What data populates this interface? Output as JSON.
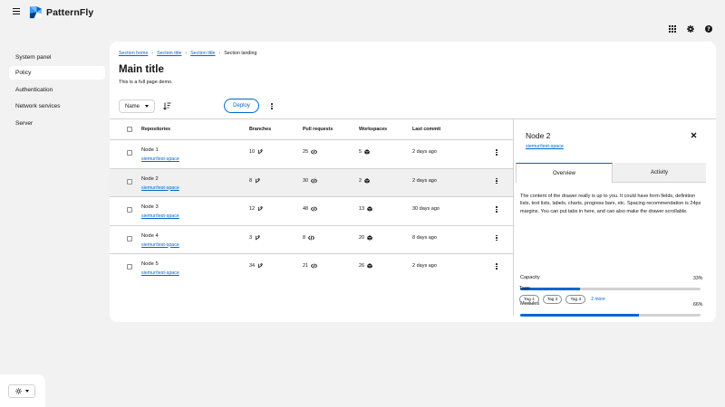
{
  "masthead": {
    "brand": "PatternFly",
    "tools": [
      "apps-grid-icon",
      "gear-icon",
      "help-icon"
    ]
  },
  "sidebar": {
    "items": [
      {
        "label": "System panel",
        "active": false
      },
      {
        "label": "Policy",
        "active": true
      },
      {
        "label": "Authentication",
        "active": false
      },
      {
        "label": "Network services",
        "active": false
      },
      {
        "label": "Server",
        "active": false
      }
    ],
    "theme_icon": "sun-icon"
  },
  "breadcrumb": {
    "items": [
      "Section home",
      "Section title",
      "Section title"
    ],
    "current": "Section landing"
  },
  "page": {
    "title": "Main title",
    "description": "This is a full page demo."
  },
  "toolbar": {
    "select_value": "Name",
    "deploy_label": "Deploy"
  },
  "table": {
    "columns": [
      "Repositories",
      "Branches",
      "Pull requests",
      "Workspaces",
      "Last commit"
    ],
    "rows": [
      {
        "name": "Node 1",
        "link": "siemur/test-space",
        "branches": "10",
        "prs": "25",
        "workspaces": "5",
        "last_commit": "2 days ago",
        "selected": false
      },
      {
        "name": "Node 2",
        "link": "siemur/test-space",
        "branches": "8",
        "prs": "30",
        "workspaces": "2",
        "last_commit": "2 days ago",
        "selected": true
      },
      {
        "name": "Node 3",
        "link": "siemur/test-space",
        "branches": "12",
        "prs": "48",
        "workspaces": "13",
        "last_commit": "30 days ago",
        "selected": false
      },
      {
        "name": "Node 4",
        "link": "siemur/test-space",
        "branches": "3",
        "prs": "8",
        "workspaces": "20",
        "last_commit": "8 days ago",
        "selected": false
      },
      {
        "name": "Node 5",
        "link": "siemur/test-space",
        "branches": "34",
        "prs": "21",
        "workspaces": "26",
        "last_commit": "2 days ago",
        "selected": false
      }
    ]
  },
  "drawer": {
    "title": "Node 2",
    "link": "siemur/test-space",
    "tabs": [
      "Overview",
      "Activity"
    ],
    "active_tab": "Overview",
    "body": "The content of the drawer really is up to you. It could have form fields, definition lists, text lists, labels, charts, progress bars, etc. Spacing recommendation is 24px margins. You can put tabs in here, and can also make the drawer scrollable.",
    "progress": [
      {
        "label": "Capacity",
        "value_text": "33%",
        "value": 0.33
      },
      {
        "label": "Modules",
        "value_text": "66%",
        "value": 0.66
      }
    ],
    "tags_label": "Tags",
    "tags": [
      "Tag 1",
      "Tag 2",
      "Tag 3"
    ],
    "tags_more": "2 more"
  },
  "colors": {
    "accent": "#0066cc",
    "page_bg": "#f2f2f2",
    "card_bg": "#ffffff",
    "border": "#d2d2d2",
    "selected_row": "#f0f0f0"
  }
}
